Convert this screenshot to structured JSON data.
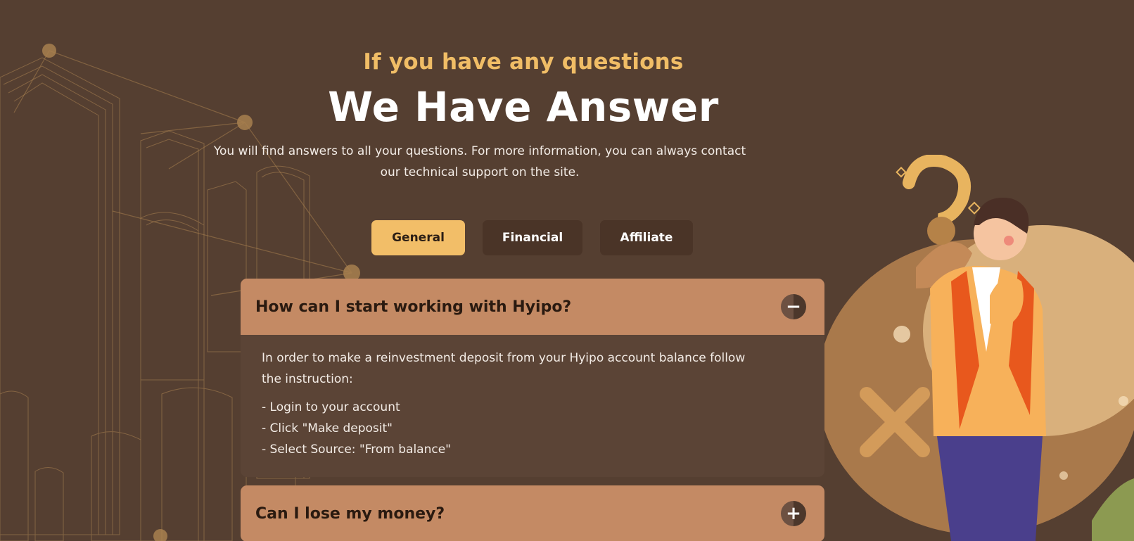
{
  "header": {
    "subtitle": "If you have any questions",
    "title": "We Have Answer",
    "description": "You will find answers to all your questions. For more information, you can always contact our technical support on the site."
  },
  "tabs": [
    {
      "label": "General",
      "active": true
    },
    {
      "label": "Financial",
      "active": false
    },
    {
      "label": "Affiliate",
      "active": false
    }
  ],
  "faq": [
    {
      "question": "How can I start working with Hyipo?",
      "expanded": true,
      "toggle": "−",
      "answer_intro": "In order to make a reinvestment deposit from your Hyipo account balance follow the instruction:",
      "steps": [
        "- Login to your account",
        "- Click \"Make deposit\"",
        "- Select Source: \"From balance\""
      ]
    },
    {
      "question": "Can I lose my money?",
      "expanded": false,
      "toggle": "+"
    }
  ],
  "colors": {
    "background": "#553f31",
    "accent": "#f2be68",
    "faq_header": "#c48a64",
    "tab_inactive": "#4a3427"
  },
  "icons": [
    "minus-icon",
    "plus-icon",
    "question-mark-icon"
  ]
}
